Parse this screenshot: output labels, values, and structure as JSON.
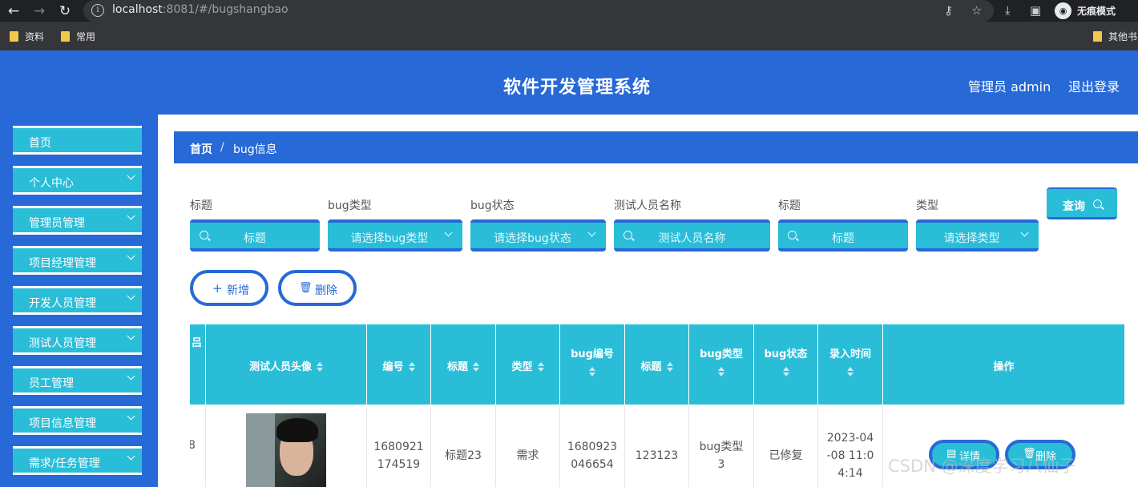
{
  "browser": {
    "url_host": "localhost",
    "url_rest": ":8081/#/bugshangbao",
    "incognito_label": "无痕模式",
    "bookmarks": [
      "资料",
      "常用"
    ],
    "other_bookmarks": "其他书"
  },
  "header": {
    "title": "软件开发管理系统",
    "user": "管理员 admin",
    "logout": "退出登录"
  },
  "sidebar": {
    "items": [
      {
        "label": "首页"
      },
      {
        "label": "个人中心"
      },
      {
        "label": "管理员管理"
      },
      {
        "label": "项目经理管理"
      },
      {
        "label": "开发人员管理"
      },
      {
        "label": "测试人员管理"
      },
      {
        "label": "员工管理"
      },
      {
        "label": "项目信息管理"
      },
      {
        "label": "需求/任务管理"
      }
    ]
  },
  "breadcrumb": {
    "home": "首页",
    "separator": "/",
    "current": "bug信息"
  },
  "filters": [
    {
      "label": "标题",
      "placeholder": "标题"
    },
    {
      "label": "bug类型",
      "placeholder": "请选择bug类型"
    },
    {
      "label": "bug状态",
      "placeholder": "请选择bug状态"
    },
    {
      "label": "测试人员名称",
      "placeholder": "测试人员名称"
    },
    {
      "label": "标题",
      "placeholder": "标题"
    },
    {
      "label": "类型",
      "placeholder": "请选择类型"
    }
  ],
  "query_button": "查询",
  "actions": {
    "add": "新增",
    "delete": "删除"
  },
  "table": {
    "columns": [
      "测试人员头像",
      "编号",
      "标题",
      "类型",
      "bug编号",
      "标题",
      "bug类型",
      "bug状态",
      "录入时间",
      "操作"
    ],
    "rows": [
      {
        "partial_first": "8",
        "number": "1680921174519",
        "title": "标题23",
        "type": "需求",
        "bug_number": "1680923046654",
        "title2": "123123",
        "bug_type": "bug类型3",
        "bug_status": "已修复",
        "entry_time": "2023-04-08 11:04:14",
        "detail_btn": "详情",
        "delete_btn": "删除"
      }
    ]
  },
  "watermark": "CSDN @深度学习八仙子"
}
